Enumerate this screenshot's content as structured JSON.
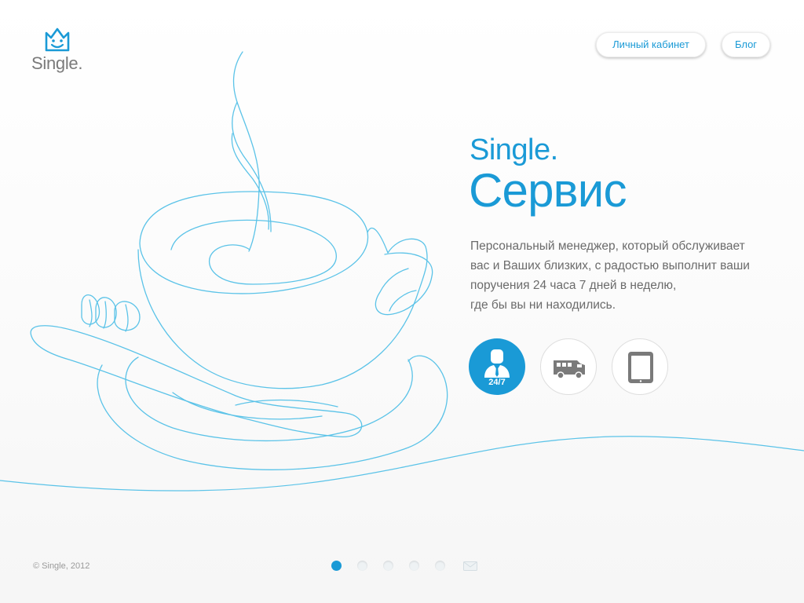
{
  "logo": {
    "text": "Single."
  },
  "nav": {
    "account_label": "Личный кабинет",
    "blog_label": "Блог"
  },
  "hero": {
    "title_small": "Single.",
    "title_big": "Сервис",
    "description_lines": [
      "Персональный менеджер, который обслуживает",
      "вас и Ваших близких, с радостью выполнит ваши",
      "поручения 24 часа 7 дней в неделю,",
      "где бы вы ни находились."
    ]
  },
  "services": [
    {
      "icon": "personal-manager-icon",
      "badge": "24/7",
      "active": true
    },
    {
      "icon": "delivery-van-icon",
      "active": false
    },
    {
      "icon": "tablet-icon",
      "active": false
    }
  ],
  "footer": {
    "copyright": "© Single, 2012"
  },
  "pager": {
    "total_dots": 5,
    "active_index": 0,
    "extra_icon": "envelope-icon"
  },
  "colors": {
    "accent": "#1a9ad6",
    "text_gray": "#6b6b6b",
    "line_blue": "#5bc3e8"
  }
}
